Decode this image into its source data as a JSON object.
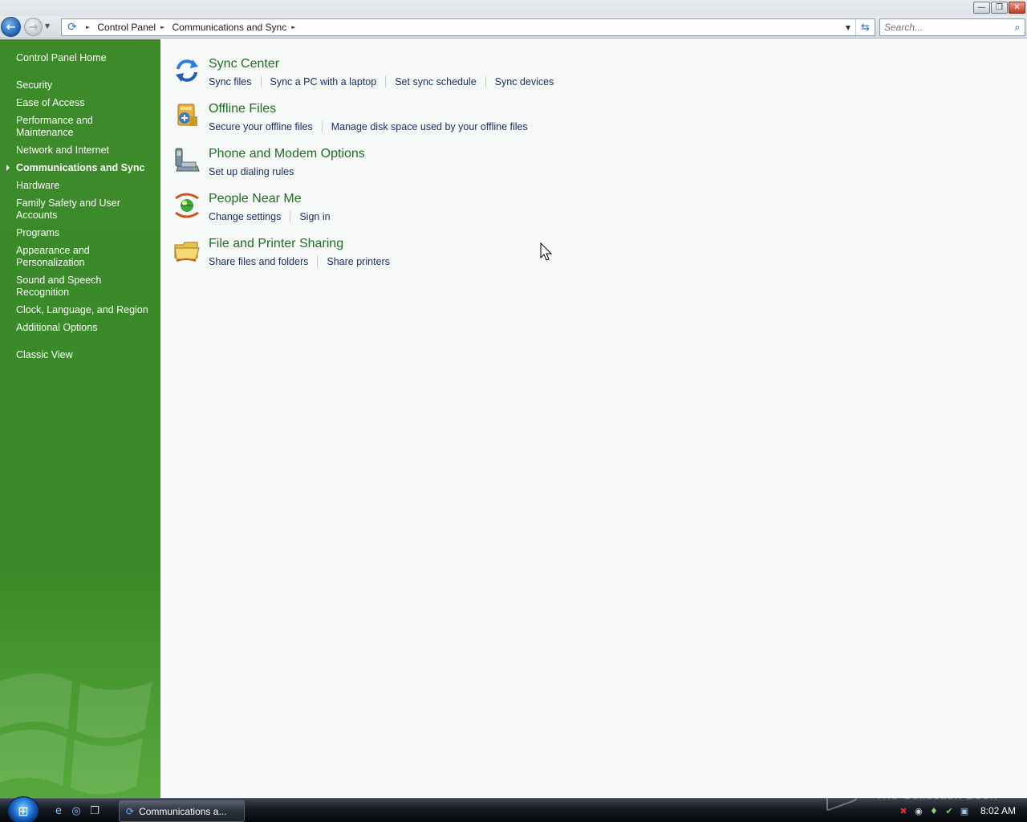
{
  "window": {
    "caption_buttons": [
      {
        "name": "minimize-button",
        "glyph": "—"
      },
      {
        "name": "maximize-button",
        "glyph": "❐"
      },
      {
        "name": "close-button",
        "glyph": "✕"
      }
    ]
  },
  "navigation": {
    "back_glyph": "←",
    "forward_glyph": "→",
    "history_dropdown_glyph": "▼",
    "address_icon_glyph": "⟳",
    "breadcrumbs": [
      "Control Panel",
      "Communications and Sync"
    ],
    "breadcrumb_sep_glyph": "►",
    "address_dropdown_glyph": "▼",
    "refresh_glyph": "⇆"
  },
  "search": {
    "placeholder": "Search...",
    "icon_glyph": "⌕"
  },
  "sidebar": {
    "home_label": "Control Panel Home",
    "items": [
      {
        "label": "Security",
        "active": false
      },
      {
        "label": "Ease of Access",
        "active": false
      },
      {
        "label": "Performance and Maintenance",
        "active": false
      },
      {
        "label": "Network and Internet",
        "active": false
      },
      {
        "label": "Communications and Sync",
        "active": true
      },
      {
        "label": "Hardware",
        "active": false
      },
      {
        "label": "Family Safety and User Accounts",
        "active": false
      },
      {
        "label": "Programs",
        "active": false
      },
      {
        "label": "Appearance and Personalization",
        "active": false
      },
      {
        "label": "Sound and Speech Recognition",
        "active": false
      },
      {
        "label": "Clock, Language, and Region",
        "active": false
      },
      {
        "label": "Additional Options",
        "active": false
      }
    ],
    "classic_view_label": "Classic View",
    "background_color": "#3c8a2a"
  },
  "categories": [
    {
      "icon": "sync-center-icon",
      "title": "Sync Center",
      "links": [
        "Sync files",
        "Sync a PC with a laptop",
        "Set sync schedule",
        "Sync devices"
      ]
    },
    {
      "icon": "offline-files-icon",
      "title": "Offline Files",
      "links": [
        "Secure your offline files",
        "Manage disk space used by your offline files"
      ]
    },
    {
      "icon": "phone-modem-icon",
      "title": "Phone and Modem Options",
      "links": [
        "Set up dialing rules"
      ]
    },
    {
      "icon": "people-near-me-icon",
      "title": "People Near Me",
      "links": [
        "Change settings",
        "Sign in"
      ]
    },
    {
      "icon": "file-printer-sharing-icon",
      "title": "File and Printer Sharing",
      "links": [
        "Share files and folders",
        "Share printers"
      ]
    }
  ],
  "colors": {
    "title_green": "#1e6e22",
    "link_blue": "#1a2e6b",
    "sidebar_green": "#3c8a2a"
  },
  "taskbar": {
    "start_glyph": "⊞",
    "quick_launch": [
      {
        "icon": "internet-explorer-icon",
        "glyph": "e"
      },
      {
        "icon": "ie-alt-icon",
        "glyph": "◎"
      },
      {
        "icon": "switch-windows-icon",
        "glyph": "❐"
      }
    ],
    "task_button": {
      "icon_glyph": "⟳",
      "label": "Communications a..."
    },
    "tray_icons": [
      {
        "icon": "security-alert-icon",
        "glyph": "✖",
        "color": "#e03030"
      },
      {
        "icon": "speaker-icon",
        "glyph": "◉",
        "color": "#cfd6de"
      },
      {
        "icon": "network-icon",
        "glyph": "♦",
        "color": "#8bd36b"
      },
      {
        "icon": "power-icon",
        "glyph": "✔",
        "color": "#7fd069"
      },
      {
        "icon": "display-icon",
        "glyph": "▣",
        "color": "#9fc8f0"
      }
    ],
    "clock": "8:02 AM"
  },
  "watermark": "The Collection Book"
}
